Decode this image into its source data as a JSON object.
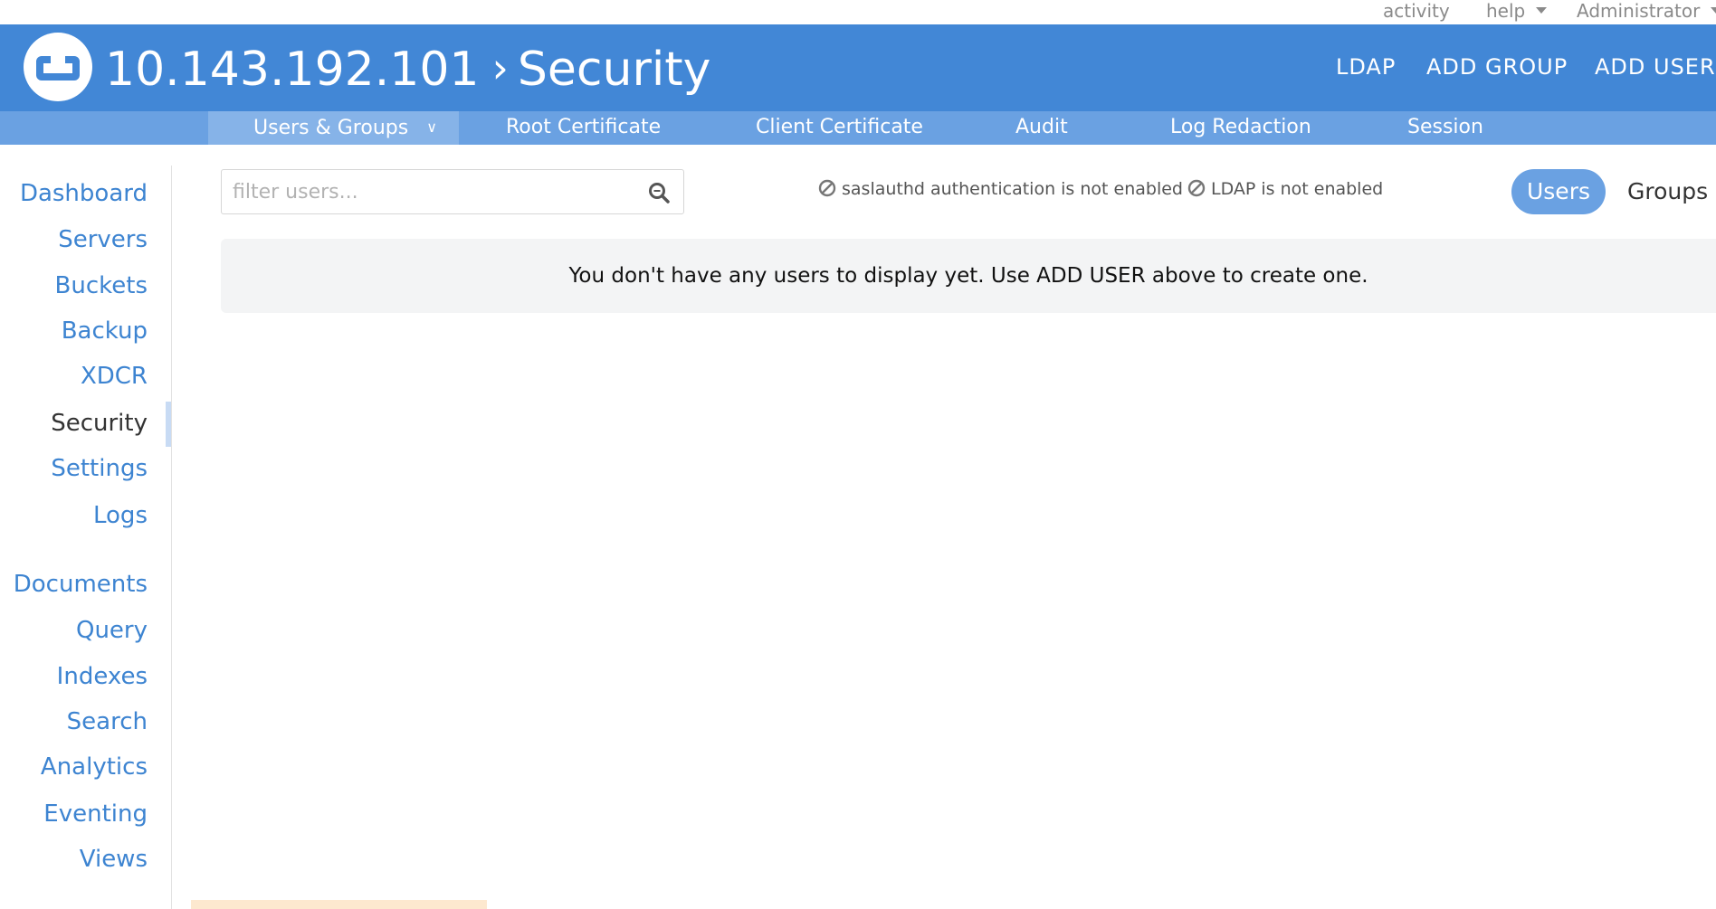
{
  "utility": {
    "activity": "activity",
    "help": "help",
    "user": "Administrator"
  },
  "header": {
    "host": "10.143.192.101",
    "separator": "›",
    "section": "Security",
    "actions": [
      "LDAP",
      "ADD GROUP",
      "ADD USER"
    ]
  },
  "subnav": {
    "tabs": [
      "Users & Groups",
      "Root Certificate",
      "Client Certificate",
      "Audit",
      "Log Redaction",
      "Session"
    ],
    "active_tab": "Users & Groups"
  },
  "sidebar": {
    "items": [
      "Dashboard",
      "Servers",
      "Buckets",
      "Backup",
      "XDCR",
      "Security",
      "Settings",
      "Logs",
      "Documents",
      "Query",
      "Indexes",
      "Search",
      "Analytics",
      "Eventing",
      "Views"
    ],
    "current": "Security"
  },
  "filter": {
    "placeholder": "filter users...",
    "value": ""
  },
  "status": {
    "saslauthd": "saslauthd authentication is not enabled",
    "ldap": "LDAP is not enabled"
  },
  "toggle": {
    "users": "Users",
    "groups": "Groups",
    "selected": "Users"
  },
  "empty_message": "You don't have any users to display yet. Use ADD USER above to create one.",
  "colors": {
    "brand_blue": "#4287d6",
    "subnav_blue": "#6aa1e2",
    "link_blue": "#3d84d1"
  },
  "icons": {
    "logo": "couchbase-logo",
    "search": "search-icon",
    "status": "ban-icon",
    "caret": "caret-down-icon",
    "chevron": "chevron-down-icon"
  }
}
